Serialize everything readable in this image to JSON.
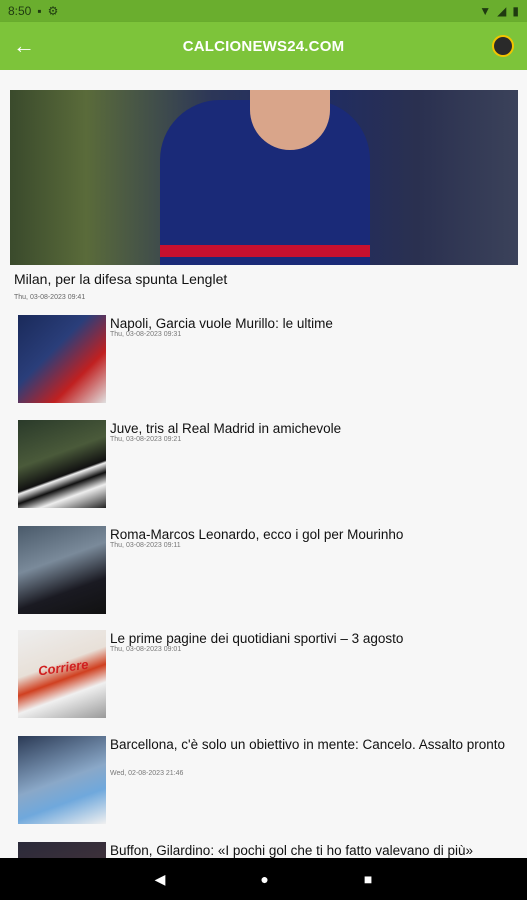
{
  "status_bar": {
    "time": "8:50"
  },
  "header": {
    "title": "CALCIONEWS24.COM",
    "back_icon": "arrow-left-icon",
    "logo_icon": "site-logo-icon"
  },
  "featured": {
    "title": "Milan, per la difesa spunta Lenglet",
    "date": "Thu, 03-08-2023 09:41"
  },
  "articles": [
    {
      "title": "Napoli, Garcia vuole Murillo: le ultime",
      "date": "Thu, 03-08-2023 09:31"
    },
    {
      "title": "Juve, tris al Real Madrid in amichevole",
      "date": "Thu, 03-08-2023 09:21"
    },
    {
      "title": "Roma-Marcos Leonardo, ecco i gol per Mourinho",
      "date": "Thu, 03-08-2023 09:11"
    },
    {
      "title": "Le prime pagine dei quotidiani sportivi – 3 agosto",
      "date": "Thu, 03-08-2023 09:01"
    },
    {
      "title": "Barcellona, c'è solo un obiettivo in mente: Cancelo. Assalto pronto",
      "date": "Wed, 02-08-2023 21:46"
    },
    {
      "title": "Buffon, Gilardino: «I pochi gol che ti ho fatto valevano di più»",
      "date": ""
    }
  ],
  "thumb_texts": {
    "article4": "Corriere"
  },
  "colors": {
    "status_bar": "#6aae2e",
    "app_bar": "#7dc43a",
    "nav_bar": "#000000"
  }
}
